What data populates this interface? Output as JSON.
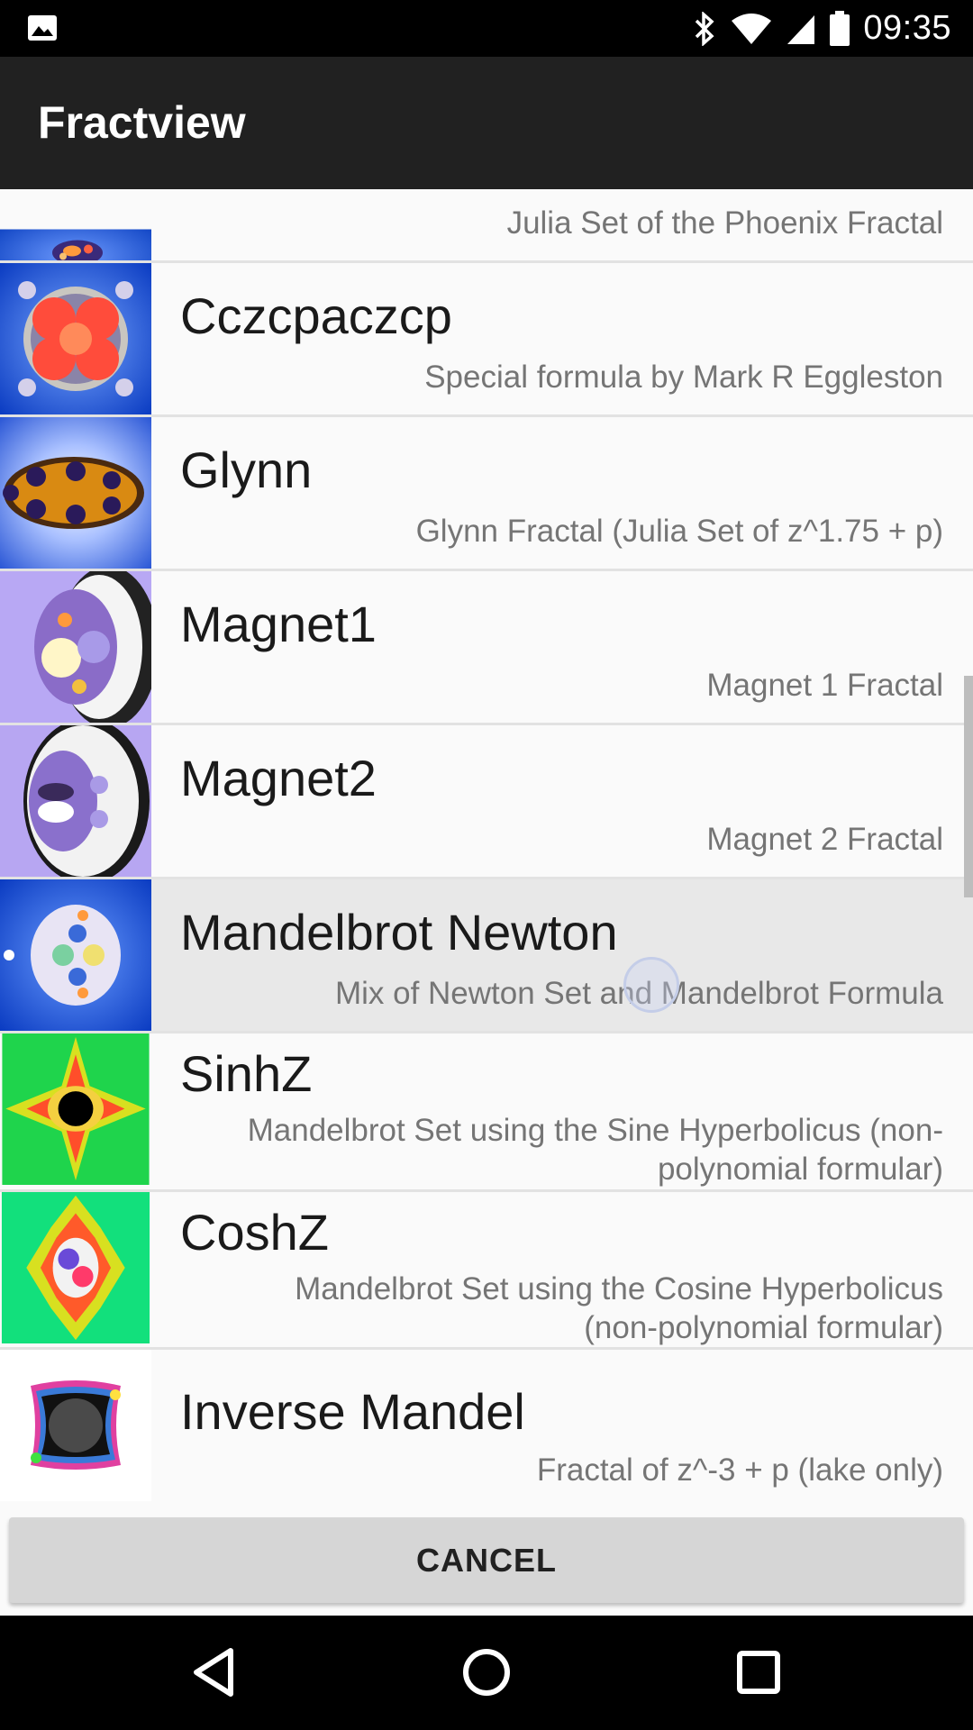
{
  "status_bar": {
    "time": "09:35",
    "icons": [
      "image-icon",
      "bluetooth-icon",
      "wifi-icon",
      "cell-signal-icon",
      "battery-icon"
    ]
  },
  "app_bar": {
    "title": "Fractview"
  },
  "list": {
    "items": [
      {
        "title": "",
        "subtitle": "Julia Set of the Phoenix Fractal"
      },
      {
        "title": "Cczcpaczcp",
        "subtitle": "Special formula by Mark R Eggleston"
      },
      {
        "title": "Glynn",
        "subtitle": "Glynn Fractal (Julia Set of z^1.75 + p)"
      },
      {
        "title": "Magnet1",
        "subtitle": "Magnet 1 Fractal"
      },
      {
        "title": "Magnet2",
        "subtitle": "Magnet 2 Fractal"
      },
      {
        "title": "Mandelbrot Newton",
        "subtitle": "Mix of Newton Set and Mandelbrot Formula"
      },
      {
        "title": "SinhZ",
        "subtitle_line1": "Mandelbrot Set using the Sine Hyperbolicus (non-",
        "subtitle_line2": "polynomial formular)"
      },
      {
        "title": "CoshZ",
        "subtitle_line1": "Mandelbrot Set using the Cosine Hyperbolicus",
        "subtitle_line2": "(non-polynomial formular)"
      },
      {
        "title": "Inverse Mandel",
        "subtitle": "Fractal of z^-3 + p (lake only)"
      }
    ]
  },
  "cancel_label": "CANCEL",
  "nav_bar": {
    "icons": [
      "back-icon",
      "home-icon",
      "recents-icon"
    ]
  }
}
